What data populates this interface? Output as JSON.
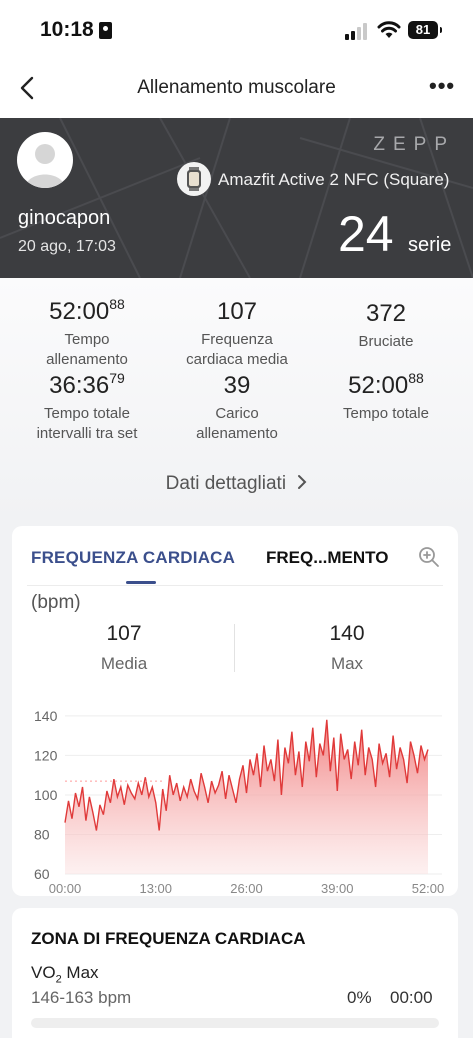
{
  "status_bar": {
    "time": "10:18",
    "battery": "81"
  },
  "nav": {
    "title": "Allenamento muscolare"
  },
  "hero": {
    "brand": "ZEPP",
    "device": "Amazfit Active 2 NFC (Square)",
    "username": "ginocapon",
    "date": "20 ago, 17:03",
    "sets_value": "24",
    "sets_unit": "serie"
  },
  "stats": {
    "workout_time": {
      "main": "52:00",
      "sup": "88",
      "label": "Tempo allenamento"
    },
    "avg_hr": {
      "value": "107",
      "label": "Frequenza cardiaca media"
    },
    "burned": {
      "value": "372",
      "label": "Bruciate"
    },
    "rest_time": {
      "main": "36:36",
      "sup": "79",
      "label": "Tempo totale intervalli tra set"
    },
    "load": {
      "value": "39",
      "label": "Carico allenamento"
    },
    "total_time": {
      "main": "52:00",
      "sup": "88",
      "label": "Tempo totale"
    }
  },
  "detail_link": "Dati dettagliati",
  "hr_card": {
    "tab_active": "FREQUENZA CARDIACA",
    "tab_other": "FREQ...MENTO",
    "unit": "(bpm)",
    "avg_value": "107",
    "avg_label": "Media",
    "max_value": "140",
    "max_label": "Max"
  },
  "chart_data": {
    "type": "area",
    "xlabel": "",
    "ylabel": "(bpm)",
    "ylim": [
      60,
      145
    ],
    "xlim": [
      0,
      52
    ],
    "yticks": [
      "140",
      "120",
      "100",
      "80",
      "60"
    ],
    "xticks": [
      "00:00",
      "13:00",
      "26:00",
      "39:00",
      "52:00"
    ],
    "average_line": 107,
    "series": [
      {
        "x": [
          0,
          0.5,
          1,
          1.5,
          2,
          2.5,
          3,
          3.5,
          4,
          4.5,
          5,
          5.5,
          6,
          6.5,
          7,
          7.5,
          8,
          8.5,
          9,
          9.5,
          10,
          10.5,
          11,
          11.5,
          12,
          12.5,
          13,
          13.5,
          14,
          14.5,
          15,
          15.5,
          16,
          16.5,
          17,
          17.5,
          18,
          18.5,
          19,
          19.5,
          20,
          20.5,
          21,
          21.5,
          22,
          22.5,
          23,
          23.5,
          24,
          24.5,
          25,
          25.5,
          26,
          26.5,
          27,
          27.5,
          28,
          28.5,
          29,
          29.5,
          30,
          30.5,
          31,
          31.5,
          32,
          32.5,
          33,
          33.5,
          34,
          34.5,
          35,
          35.5,
          36,
          36.5,
          37,
          37.5,
          38,
          38.5,
          39,
          39.5,
          40,
          40.5,
          41,
          41.5,
          42,
          42.5,
          43,
          43.5,
          44,
          44.5,
          45,
          45.5,
          46,
          46.5,
          47,
          47.5,
          48,
          48.5,
          49,
          49.5,
          50,
          50.5,
          51,
          51.5,
          52
        ],
        "values": [
          86,
          97,
          88,
          101,
          94,
          104,
          87,
          99,
          91,
          82,
          95,
          90,
          102,
          96,
          108,
          99,
          104,
          95,
          105,
          101,
          98,
          106,
          100,
          109,
          99,
          104,
          96,
          82,
          103,
          92,
          110,
          100,
          106,
          97,
          104,
          99,
          108,
          102,
          98,
          111,
          104,
          96,
          107,
          101,
          105,
          112,
          98,
          110,
          103,
          96,
          108,
          115,
          101,
          118,
          110,
          121,
          104,
          125,
          112,
          118,
          107,
          128,
          100,
          124,
          116,
          132,
          110,
          122,
          104,
          127,
          117,
          134,
          109,
          126,
          120,
          138,
          112,
          129,
          102,
          131,
          118,
          123,
          108,
          127,
          115,
          133,
          110,
          124,
          118,
          104,
          126,
          116,
          121,
          109,
          130,
          113,
          124,
          118,
          106,
          127,
          120,
          111,
          125,
          118,
          123
        ]
      }
    ]
  },
  "zone_card": {
    "title": "ZONA DI FREQUENZA CARDIACA",
    "zone_name_main": "VO",
    "zone_name_sub": "2",
    "zone_name_rest": " Max",
    "zone_range": "146-163 bpm",
    "zone_percent": "0%",
    "zone_time": "00:00"
  }
}
